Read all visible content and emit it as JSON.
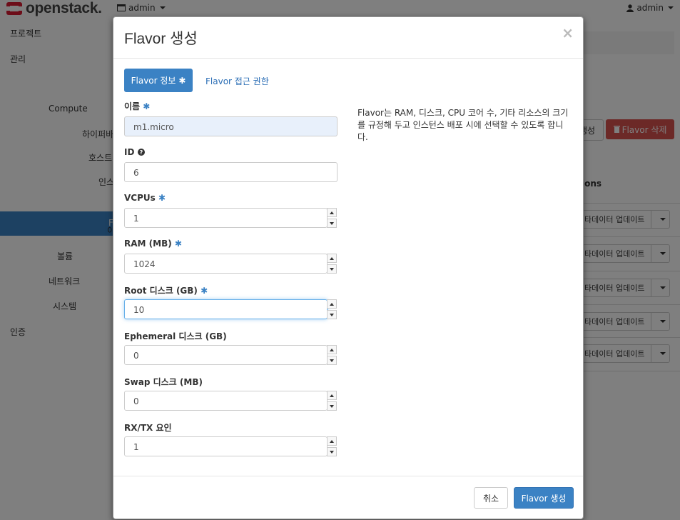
{
  "topbar": {
    "brand": "openstack.",
    "project": "admin",
    "user": "admin"
  },
  "sidebar": {
    "items": [
      "프로젝트",
      "관리",
      "Compute",
      "하이퍼바",
      "호스트",
      "인스",
      "F",
      "이",
      "볼륨",
      "네트워크",
      "시스템",
      "인증"
    ]
  },
  "background": {
    "create_button": "생성",
    "delete_button": "Flavor 삭제",
    "actions_header": "ions",
    "row_action": "타데이터 업데이트"
  },
  "modal": {
    "title": "Flavor 생성",
    "close": "×",
    "tabs": {
      "info": "Flavor 정보",
      "access": "Flavor 접근 권한"
    },
    "help": "Flavor는 RAM, 디스크, CPU 코어 수, 기타 리소스의 크기를 규정해 두고 인스턴스 배포 시에 선택할 수 있도록 합니다.",
    "fields": {
      "name": {
        "label": "이름",
        "value": "m1.micro"
      },
      "id": {
        "label": "ID",
        "value": "6"
      },
      "vcpus": {
        "label": "VCPUs",
        "value": "1"
      },
      "ram": {
        "label": "RAM (MB)",
        "value": "1024"
      },
      "root": {
        "label": "Root 디스크 (GB)",
        "value": "10"
      },
      "ephemeral": {
        "label": "Ephemeral 디스크 (GB)",
        "value": "0"
      },
      "swap": {
        "label": "Swap 디스크 (MB)",
        "value": "0"
      },
      "rxtx": {
        "label": "RX/TX 요인",
        "value": "1"
      }
    },
    "required_mark": "✱",
    "buttons": {
      "cancel": "취소",
      "submit": "Flavor 생성"
    }
  },
  "colors": {
    "primary": "#3b82c4",
    "danger": "#d9534f",
    "brand_red": "#da1a32"
  }
}
